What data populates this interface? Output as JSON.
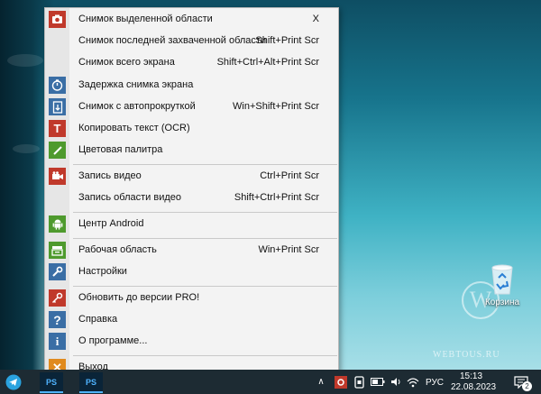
{
  "menu": {
    "items": [
      {
        "label": "Снимок выделенной области",
        "shortcut": "X",
        "icon": "camera-icon",
        "color": "#c0392b"
      },
      {
        "label": "Снимок последней захваченной области",
        "shortcut": "Shift+Print Scr",
        "icon": "",
        "color": ""
      },
      {
        "label": "Снимок всего экрана",
        "shortcut": "Shift+Ctrl+Alt+Print Scr",
        "icon": "",
        "color": ""
      },
      {
        "label": "Задержка снимка экрана",
        "shortcut": "",
        "icon": "timer-icon",
        "color": "#3a6ea5"
      },
      {
        "label": "Снимок с автопрокруткой",
        "shortcut": "Win+Shift+Print Scr",
        "icon": "scroll-capture-icon",
        "color": "#3a6ea5"
      },
      {
        "label": "Копировать текст (OCR)",
        "shortcut": "",
        "icon": "text-icon",
        "color": "#c0392b"
      },
      {
        "label": "Цветовая палитра",
        "shortcut": "",
        "icon": "eyedropper-icon",
        "color": "#4e9a2d"
      },
      {
        "label": "Запись видео",
        "shortcut": "Ctrl+Print Scr",
        "icon": "video-camera-icon",
        "color": "#c0392b"
      },
      {
        "label": "Запись области видео",
        "shortcut": "Shift+Ctrl+Print Scr",
        "icon": "",
        "color": ""
      },
      {
        "label": "Центр Android",
        "shortcut": "",
        "icon": "android-icon",
        "color": "#4e9a2d"
      },
      {
        "label": "Рабочая область",
        "shortcut": "Win+Print Scr",
        "icon": "workspace-icon",
        "color": "#4e9a2d"
      },
      {
        "label": "Настройки",
        "shortcut": "",
        "icon": "wrench-icon",
        "color": "#3a6ea5"
      },
      {
        "label": "Обновить до версии PRO!",
        "shortcut": "",
        "icon": "key-icon",
        "color": "#c0392b"
      },
      {
        "label": "Справка",
        "shortcut": "",
        "icon": "help-icon",
        "color": "#3a6ea5"
      },
      {
        "label": "О программе...",
        "shortcut": "",
        "icon": "info-icon",
        "color": "#3a6ea5"
      },
      {
        "label": "Выход",
        "shortcut": "",
        "icon": "exit-icon",
        "color": "#e08a1e"
      }
    ]
  },
  "desktop": {
    "recycle_bin_label": "Корзина",
    "watermark": "WEBTOUS.RU"
  },
  "taskbar": {
    "language": "РУС",
    "time": "15:13",
    "date": "22.08.2023",
    "notification_count": "2",
    "app_label_1": "PS",
    "app_label_2": "PS"
  }
}
